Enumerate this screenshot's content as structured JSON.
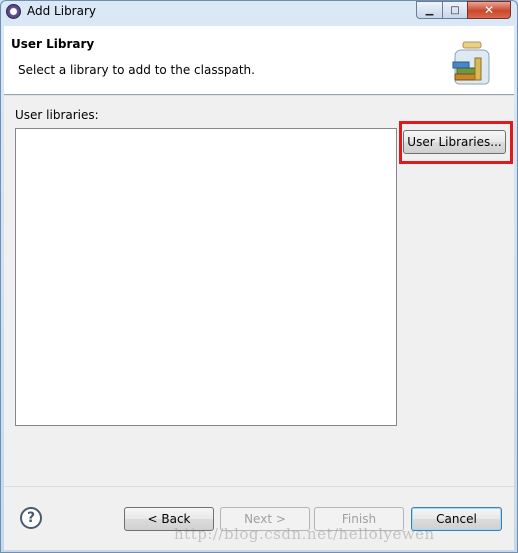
{
  "window": {
    "title": "Add Library",
    "controls": {
      "minimize_icon": "minimize-icon",
      "maximize_icon": "maximize-icon",
      "close_icon": "close-icon"
    }
  },
  "header": {
    "title": "User Library",
    "description": "Select a library to add to the classpath.",
    "icon": "library-jar-icon"
  },
  "main": {
    "list_label": "User libraries:",
    "list_items": [],
    "user_libraries_button": "User Libraries..."
  },
  "footer": {
    "help_icon": "help-icon",
    "help_glyph": "?",
    "back_label": "< Back",
    "next_label": "Next >",
    "finish_label": "Finish",
    "cancel_label": "Cancel"
  },
  "annotations": {
    "highlight_color": "#e01a1a",
    "watermark": "http://blog.csdn.net/hellolyewen"
  }
}
